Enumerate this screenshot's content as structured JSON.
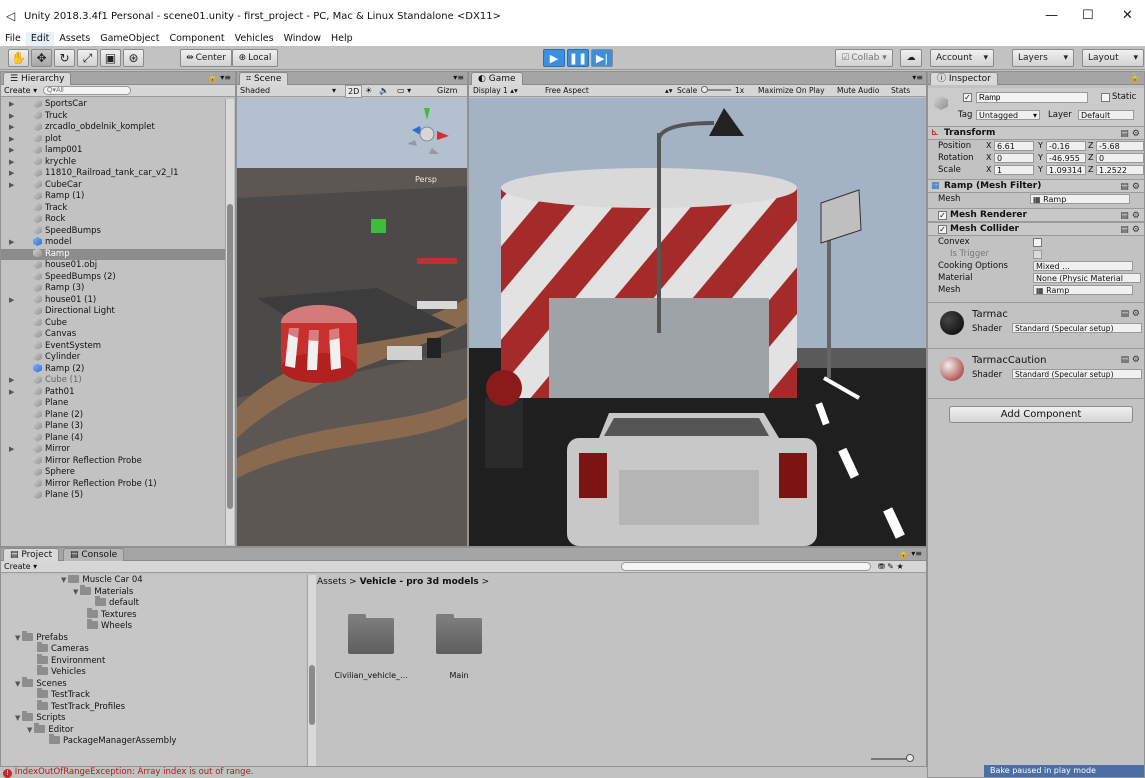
{
  "window": {
    "title": "Unity 2018.3.4f1 Personal - scene01.unity - first_project - PC, Mac & Linux Standalone <DX11>",
    "min": "—",
    "max": "☐",
    "close": "✕"
  },
  "menu": [
    "File",
    "Edit",
    "Assets",
    "GameObject",
    "Component",
    "Vehicles",
    "Window",
    "Help"
  ],
  "toolbar": {
    "center": "Center",
    "local": "Local",
    "collab": "Collab",
    "account": "Account",
    "layers": "Layers",
    "layout": "Layout"
  },
  "hierarchy": {
    "tab": "Hierarchy",
    "create": "Create",
    "search_placeholder": "Q▾All",
    "items": [
      {
        "label": "SportsCar",
        "arrow": "▶",
        "sel": false,
        "faded": false,
        "icon": "cube"
      },
      {
        "label": "Truck",
        "arrow": "▶",
        "sel": false,
        "faded": false,
        "icon": "cube"
      },
      {
        "label": "zrcadlo_obdelnik_komplet",
        "arrow": "▶",
        "sel": false,
        "faded": false,
        "icon": "cube"
      },
      {
        "label": "plot",
        "arrow": "▶",
        "sel": false,
        "faded": false,
        "icon": "cube"
      },
      {
        "label": "lamp001",
        "arrow": "▶",
        "sel": false,
        "faded": false,
        "icon": "cube"
      },
      {
        "label": "krychle",
        "arrow": "▶",
        "sel": false,
        "faded": false,
        "icon": "cube"
      },
      {
        "label": "11810_Railroad_tank_car_v2_l1",
        "arrow": "▶",
        "sel": false,
        "faded": false,
        "icon": "cube"
      },
      {
        "label": "CubeCar",
        "arrow": "▶",
        "sel": false,
        "faded": false,
        "icon": "cube"
      },
      {
        "label": "Ramp (1)",
        "arrow": "",
        "sel": false,
        "faded": false,
        "icon": "cube"
      },
      {
        "label": "Track",
        "arrow": "",
        "sel": false,
        "faded": false,
        "icon": "cube"
      },
      {
        "label": "Rock",
        "arrow": "",
        "sel": false,
        "faded": false,
        "icon": "cube"
      },
      {
        "label": "SpeedBumps",
        "arrow": "",
        "sel": false,
        "faded": false,
        "icon": "cube"
      },
      {
        "label": "model",
        "arrow": "▶",
        "sel": false,
        "faded": false,
        "icon": "blue"
      },
      {
        "label": "Ramp",
        "arrow": "",
        "sel": true,
        "faded": false,
        "icon": "cube"
      },
      {
        "label": "house01.obj",
        "arrow": "",
        "sel": false,
        "faded": false,
        "icon": "cube"
      },
      {
        "label": "SpeedBumps (2)",
        "arrow": "",
        "sel": false,
        "faded": false,
        "icon": "cube"
      },
      {
        "label": "Ramp (3)",
        "arrow": "",
        "sel": false,
        "faded": false,
        "icon": "cube"
      },
      {
        "label": "house01 (1)",
        "arrow": "▶",
        "sel": false,
        "faded": false,
        "icon": "cube"
      },
      {
        "label": "Directional Light",
        "arrow": "",
        "sel": false,
        "faded": false,
        "icon": "cube"
      },
      {
        "label": "Cube",
        "arrow": "",
        "sel": false,
        "faded": false,
        "icon": "cube"
      },
      {
        "label": "Canvas",
        "arrow": "",
        "sel": false,
        "faded": false,
        "icon": "cube"
      },
      {
        "label": "EventSystem",
        "arrow": "",
        "sel": false,
        "faded": false,
        "icon": "cube"
      },
      {
        "label": "Cylinder",
        "arrow": "",
        "sel": false,
        "faded": false,
        "icon": "cube"
      },
      {
        "label": "Ramp (2)",
        "arrow": "",
        "sel": false,
        "faded": false,
        "icon": "blue"
      },
      {
        "label": "Cube (1)",
        "arrow": "▶",
        "sel": false,
        "faded": true,
        "icon": "cube"
      },
      {
        "label": "Path01",
        "arrow": "▶",
        "sel": false,
        "faded": false,
        "icon": "cube"
      },
      {
        "label": "Plane",
        "arrow": "",
        "sel": false,
        "faded": false,
        "icon": "cube"
      },
      {
        "label": "Plane (2)",
        "arrow": "",
        "sel": false,
        "faded": false,
        "icon": "cube"
      },
      {
        "label": "Plane (3)",
        "arrow": "",
        "sel": false,
        "faded": false,
        "icon": "cube"
      },
      {
        "label": "Plane (4)",
        "arrow": "",
        "sel": false,
        "faded": false,
        "icon": "cube"
      },
      {
        "label": "Mirror",
        "arrow": "▶",
        "sel": false,
        "faded": false,
        "icon": "cube"
      },
      {
        "label": "Mirror Reflection Probe",
        "arrow": "",
        "sel": false,
        "faded": false,
        "icon": "cube"
      },
      {
        "label": "Sphere",
        "arrow": "",
        "sel": false,
        "faded": false,
        "icon": "cube"
      },
      {
        "label": "Mirror Reflection Probe (1)",
        "arrow": "",
        "sel": false,
        "faded": false,
        "icon": "cube"
      },
      {
        "label": "Plane (5)",
        "arrow": "",
        "sel": false,
        "faded": false,
        "icon": "cube"
      }
    ]
  },
  "scene": {
    "tab": "Scene",
    "shaded": "Shaded",
    "mode2d": "2D",
    "gizmos": "Gizm",
    "persp": "Persp"
  },
  "game": {
    "tab": "Game",
    "display": "Display 1",
    "aspect": "Free Aspect",
    "scale_label": "Scale",
    "scale_value": "1x",
    "maximize": "Maximize On Play",
    "mute": "Mute Audio",
    "stats": "Stats"
  },
  "inspector": {
    "tab": "Inspector",
    "name": "Ramp",
    "static": "Static",
    "tag_label": "Tag",
    "tag": "Untagged",
    "layer_label": "Layer",
    "layer": "Default",
    "transform": {
      "title": "Transform",
      "rows": [
        {
          "label": "Position",
          "x": "6.61",
          "y": "-0.16",
          "z": "-5.68"
        },
        {
          "label": "Rotation",
          "x": "0",
          "y": "-46.955",
          "z": "0"
        },
        {
          "label": "Scale",
          "x": "1",
          "y": "1.09314",
          "z": "1.2522"
        }
      ]
    },
    "mesh_filter": {
      "title": "Ramp (Mesh Filter)",
      "mesh_label": "Mesh",
      "mesh": "Ramp"
    },
    "mesh_renderer": {
      "title": "Mesh Renderer"
    },
    "mesh_collider": {
      "title": "Mesh Collider",
      "convex": "Convex",
      "trigger": "Is Trigger",
      "cooking_label": "Cooking Options",
      "cooking": "Mixed ...",
      "material_label": "Material",
      "material": "None (Physic Material",
      "mesh_label": "Mesh",
      "mesh": "Ramp"
    },
    "materials": [
      {
        "name": "Tarmac",
        "shader_label": "Shader",
        "shader": "Standard (Specular setup)"
      },
      {
        "name": "TarmacCaution",
        "shader_label": "Shader",
        "shader": "Standard (Specular setup)"
      }
    ],
    "add_component": "Add Component"
  },
  "project": {
    "tab_project": "Project",
    "tab_console": "Console",
    "create": "Create",
    "tree": [
      {
        "label": "Muscle Car 04",
        "indent": 60,
        "arrow": "▼"
      },
      {
        "label": "Materials",
        "indent": 72,
        "arrow": "▼"
      },
      {
        "label": "default",
        "indent": 92,
        "arrow": ""
      },
      {
        "label": "Textures",
        "indent": 84,
        "arrow": ""
      },
      {
        "label": "Wheels",
        "indent": 84,
        "arrow": ""
      },
      {
        "label": "Prefabs",
        "indent": 14,
        "arrow": "▼"
      },
      {
        "label": "Cameras",
        "indent": 34,
        "arrow": ""
      },
      {
        "label": "Environment",
        "indent": 34,
        "arrow": ""
      },
      {
        "label": "Vehicles",
        "indent": 34,
        "arrow": ""
      },
      {
        "label": "Scenes",
        "indent": 14,
        "arrow": "▼"
      },
      {
        "label": "TestTrack",
        "indent": 34,
        "arrow": ""
      },
      {
        "label": "TestTrack_Profiles",
        "indent": 34,
        "arrow": ""
      },
      {
        "label": "Scripts",
        "indent": 14,
        "arrow": "▼"
      },
      {
        "label": "Editor",
        "indent": 26,
        "arrow": "▼"
      },
      {
        "label": "PackageManagerAssembly",
        "indent": 46,
        "arrow": ""
      }
    ],
    "breadcrumb": {
      "root": "Assets",
      "sep": ">",
      "current": "Vehicle - pro 3d models",
      "end": ">"
    },
    "assets": [
      {
        "label": "Civilian_vehicle_..."
      },
      {
        "label": "Main"
      }
    ]
  },
  "status": {
    "error": "IndexOutOfRangeException: Array index is out of range.",
    "bake": "Bake paused in play mode"
  }
}
